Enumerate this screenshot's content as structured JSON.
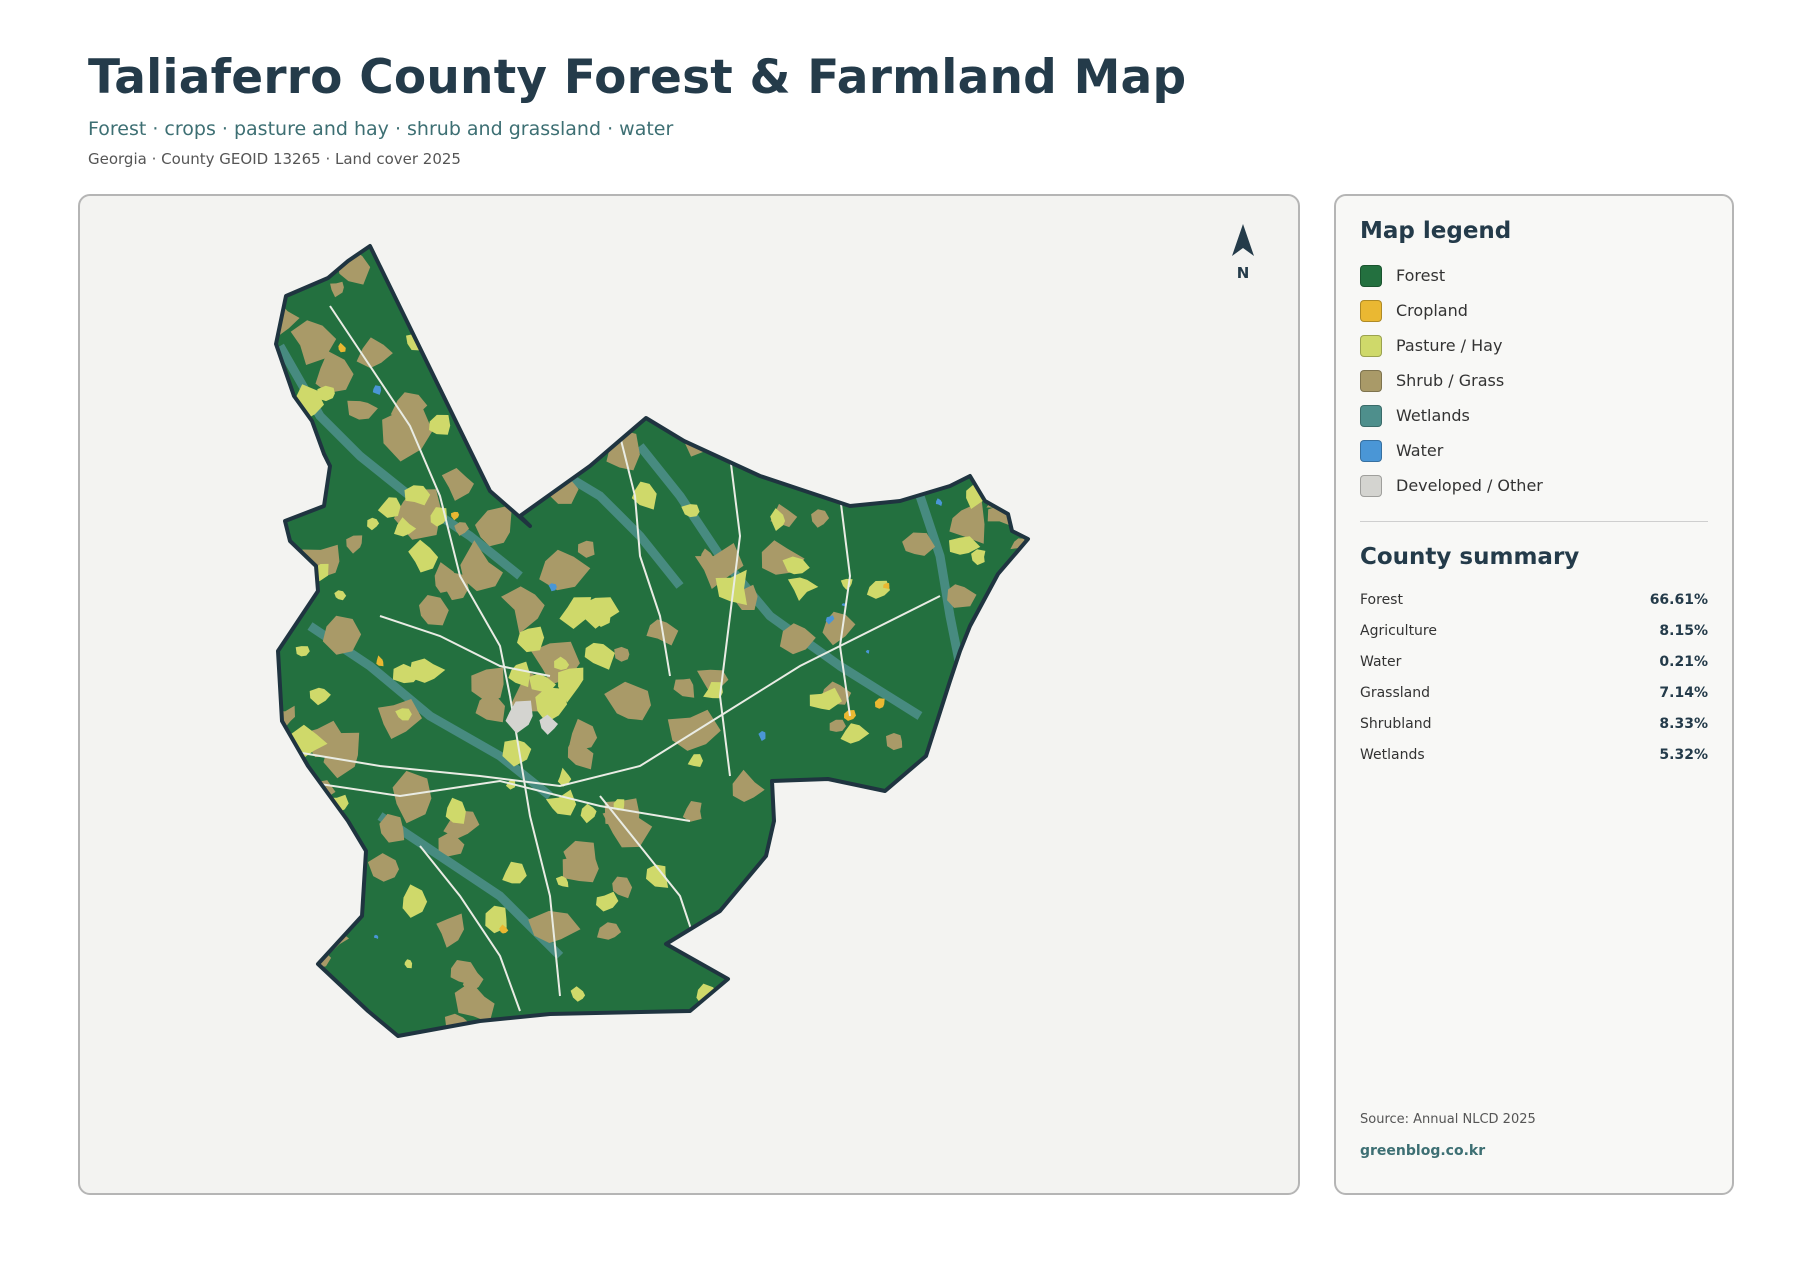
{
  "header": {
    "title": "Taliaferro County Forest & Farmland Map",
    "subtitle": "Forest · crops · pasture and hay · shrub and grassland · water",
    "meta": "Georgia · County GEOID 13265 · Land cover 2025"
  },
  "map": {
    "north_label": "N",
    "colors": {
      "forest": "#23703f",
      "cropland": "#eab832",
      "pasture": "#cfd96a",
      "shrub": "#a99a68",
      "wetlands": "#4e8f8c",
      "water": "#4a96d6",
      "developed": "#d4d4d0",
      "outline": "#1f3440"
    }
  },
  "legend": {
    "title": "Map legend",
    "items": [
      {
        "label": "Forest",
        "color": "#23703f"
      },
      {
        "label": "Cropland",
        "color": "#eab832"
      },
      {
        "label": "Pasture / Hay",
        "color": "#cfd96a"
      },
      {
        "label": "Shrub / Grass",
        "color": "#a99a68"
      },
      {
        "label": "Wetlands",
        "color": "#4e8f8c"
      },
      {
        "label": "Water",
        "color": "#4a96d6"
      },
      {
        "label": "Developed / Other",
        "color": "#d4d4d0"
      }
    ]
  },
  "summary": {
    "title": "County summary",
    "rows": [
      {
        "label": "Forest",
        "value": "66.61%"
      },
      {
        "label": "Agriculture",
        "value": "8.15%"
      },
      {
        "label": "Water",
        "value": "0.21%"
      },
      {
        "label": "Grassland",
        "value": "7.14%"
      },
      {
        "label": "Shrubland",
        "value": "8.33%"
      },
      {
        "label": "Wetlands",
        "value": "5.32%"
      }
    ]
  },
  "footer": {
    "source": "Source: Annual NLCD 2025",
    "brand": "greenblog.co.kr"
  }
}
